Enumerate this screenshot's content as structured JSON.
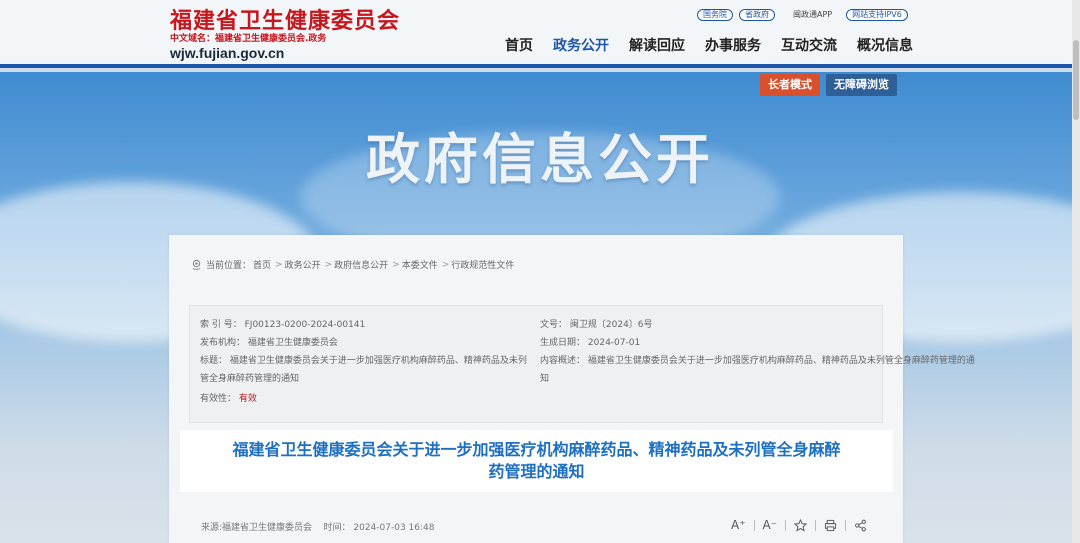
{
  "header": {
    "site_name": "福建省卫生健康委员会",
    "cn_domain": "中文域名：福建省卫生健康委员会.政务",
    "domain": "wjw.fujian.gov.cn",
    "toplinks": [
      "国务院",
      "省政府"
    ],
    "app_link": "闽政通APP",
    "ipv6": "网站支持IPV6",
    "nav": [
      "首页",
      "政务公开",
      "解读回应",
      "办事服务",
      "互动交流",
      "概况信息"
    ]
  },
  "banner": {
    "title": "政府信息公开",
    "elder_mode": "长者模式",
    "accessible": "无障碍浏览"
  },
  "breadcrumb": {
    "prefix": "当前位置：",
    "items": [
      "首页",
      "政务公开",
      "政府信息公开",
      "本委文件",
      "行政规范性文件"
    ]
  },
  "meta": {
    "index_label": "索 引 号：",
    "index_value": "FJ00123-0200-2024-00141",
    "doc_no_label": "文号：",
    "doc_no_value": "闽卫规〔2024〕6号",
    "publisher_label": "发布机构：",
    "publisher_value": "福建省卫生健康委员会",
    "date_label": "生成日期：",
    "date_value": "2024-07-01",
    "title_label": "标题：",
    "title_value_1": "福建省卫生健康委员会关于进一步加强医疗机构麻醉药品、精神药品及未列",
    "title_value_2": "管全身麻醉药管理的通知",
    "summary_label": "内容概述：",
    "summary_value_1": "福建省卫生健康委员会关于进一步加强医疗机构麻醉药品、精神药品及未列管全身麻醉药管理的通",
    "summary_value_2": "知",
    "validity_label": "有效性：",
    "validity_value": "有效"
  },
  "headline": {
    "line1": "福建省卫生健康委员会关于进一步加强医疗机构麻醉药品、精神药品及未列管全身麻醉",
    "line2": "药管理的通知"
  },
  "footer": {
    "source": "来源:福建省卫生健康委员会",
    "time": "时间：  2024-07-03 16:48",
    "font_up": "A⁺",
    "font_down": "A⁻"
  }
}
